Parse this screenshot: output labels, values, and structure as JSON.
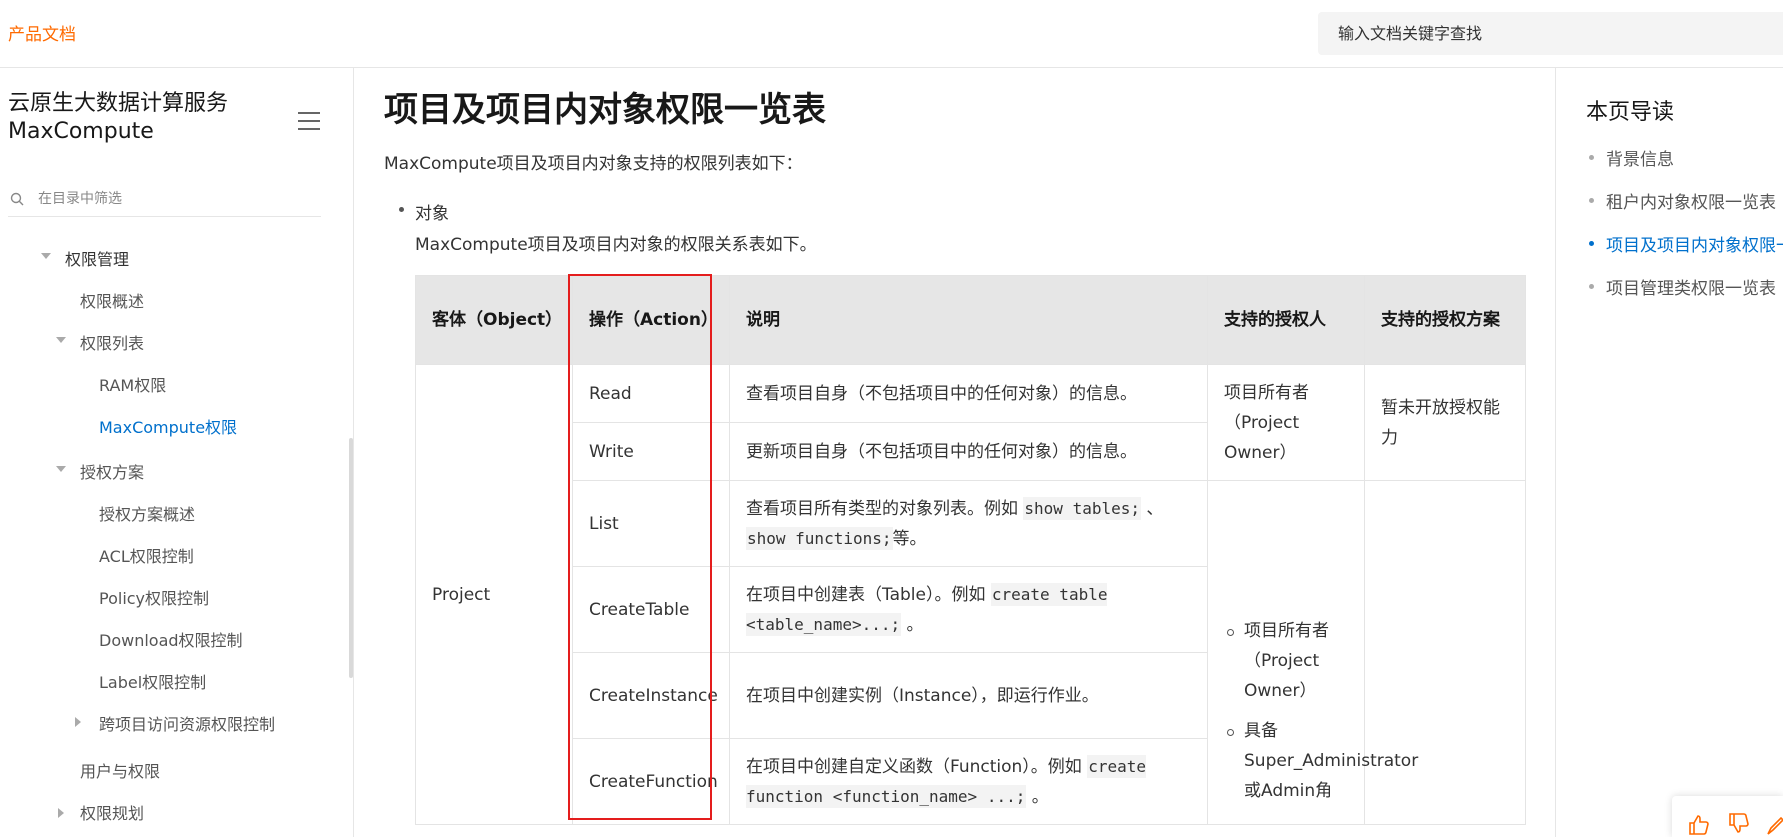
{
  "header": {
    "brand": "产品文档",
    "search_placeholder": "输入文档关键字查找"
  },
  "sidebar": {
    "title": "云原生大数据计算服务 MaxCompute",
    "filter_placeholder": "在目录中筛选",
    "items": [
      {
        "label": "权限管理"
      },
      {
        "label": "权限概述"
      },
      {
        "label": "权限列表"
      },
      {
        "label": "RAM权限"
      },
      {
        "label": "MaxCompute权限"
      },
      {
        "label": "授权方案"
      },
      {
        "label": "授权方案概述"
      },
      {
        "label": "ACL权限控制"
      },
      {
        "label": "Policy权限控制"
      },
      {
        "label": "Download权限控制"
      },
      {
        "label": "Label权限控制"
      },
      {
        "label": "跨项目访问资源权限控制"
      },
      {
        "label": "用户与权限"
      },
      {
        "label": "权限规划"
      }
    ]
  },
  "main": {
    "title": "项目及项目内对象权限一览表",
    "intro": "MaxCompute项目及项目内对象支持的权限列表如下：",
    "bullet_label": "对象",
    "bullet_text": "MaxCompute项目及项目内对象的权限关系表如下。",
    "table": {
      "headers": [
        "客体（Object）",
        "操作（Action）",
        "说明",
        "支持的授权人",
        "支持的授权方案"
      ],
      "object": "Project",
      "rows": [
        {
          "action": "Read",
          "desc": "查看项目自身（不包括项目中的任何对象）的信息。"
        },
        {
          "action": "Write",
          "desc": "更新项目自身（不包括项目中的任何对象）的信息。"
        },
        {
          "action": "List",
          "desc_pre": "查看项目所有类型的对象列表。例如",
          "code1": "show tables;",
          "sep": "、",
          "code2": "show functions;",
          "desc_post": "等。"
        },
        {
          "action": "CreateTable",
          "desc_pre": "在项目中创建表（Table）。例如",
          "code1": "create table <table_name>...;",
          "desc_post": "。"
        },
        {
          "action": "CreateInstance",
          "desc": "在项目中创建实例（Instance），即运行作业。"
        },
        {
          "action": "CreateFunction",
          "desc_pre": "在项目中创建自定义函数（Function）。例如",
          "code1": "create function <function_name> ...;",
          "desc_post": "。"
        }
      ],
      "grantor_1": "项目所有者（Project Owner）",
      "scheme_1": "暂未开放授权能力",
      "grantor_2_items": [
        "项目所有者（Project Owner）",
        "具备Super_Administrator或Admin角"
      ]
    }
  },
  "toc": {
    "title": "本页导读",
    "items": [
      {
        "label": "背景信息",
        "active": false
      },
      {
        "label": "租户内对象权限一览表",
        "active": false
      },
      {
        "label": "项目及项目内对象权限一览表",
        "active": true
      },
      {
        "label": "项目管理类权限一览表",
        "active": false
      }
    ]
  },
  "colors": {
    "brand": "#ff6a00",
    "link_active": "#0070cc",
    "highlight_box": "#e41d1d",
    "table_header_bg": "#e6e6e6"
  }
}
